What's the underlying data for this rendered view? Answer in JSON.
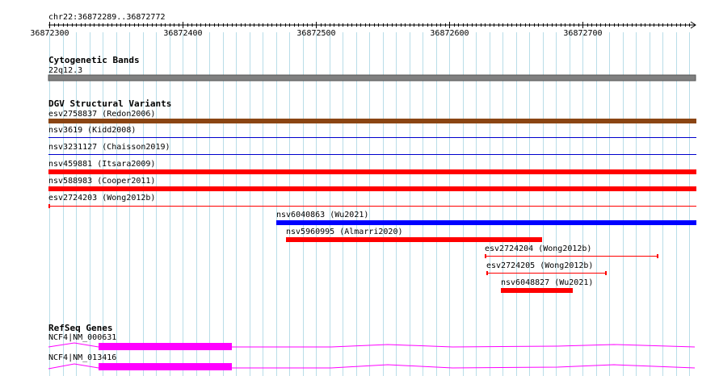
{
  "ruler": {
    "region": "chr22:36872289..36872772",
    "ticks": [
      "36872300",
      "36872400",
      "36872500",
      "36872600",
      "36872700"
    ]
  },
  "tracks": {
    "cytoband": {
      "title": "Cytogenetic Bands",
      "band_label": "22q12.3",
      "color": "#808080"
    },
    "dgv": {
      "title": "DGV Structural Variants",
      "variants": [
        {
          "label": "esv2758837 (Redon2006)",
          "color": "#8b4513",
          "style": "thick"
        },
        {
          "label": "nsv3619 (Kidd2008)",
          "color": "#0000cc",
          "style": "thin"
        },
        {
          "label": "nsv3231127 (Chaisson2019)",
          "color": "#0000cc",
          "style": "thin"
        },
        {
          "label": "nsv459881 (Itsara2009)",
          "color": "#ff0000",
          "style": "thick"
        },
        {
          "label": "nsv588983 (Cooper2011)",
          "color": "#ff0000",
          "style": "thick"
        },
        {
          "label": "esv2724203 (Wong2012b)",
          "color": "#ff0000",
          "style": "thin"
        },
        {
          "label": "nsv6040863 (Wu2021)",
          "color": "#0000ff",
          "style": "thick"
        },
        {
          "label": "nsv5960995 (Almarri2020)",
          "color": "#ff0000",
          "style": "thick"
        },
        {
          "label": "esv2724204 (Wong2012b)",
          "color": "#ff0000",
          "style": "thin"
        },
        {
          "label": "esv2724205 (Wong2012b)",
          "color": "#ff0000",
          "style": "thin"
        },
        {
          "label": "nsv6048827 (Wu2021)",
          "color": "#ff0000",
          "style": "thick"
        }
      ]
    },
    "refseq": {
      "title": "RefSeq Genes",
      "color": "#ff00ff",
      "genes": [
        {
          "label": "NCF4|NM_000631"
        },
        {
          "label": "NCF4|NM_013416"
        }
      ]
    }
  }
}
